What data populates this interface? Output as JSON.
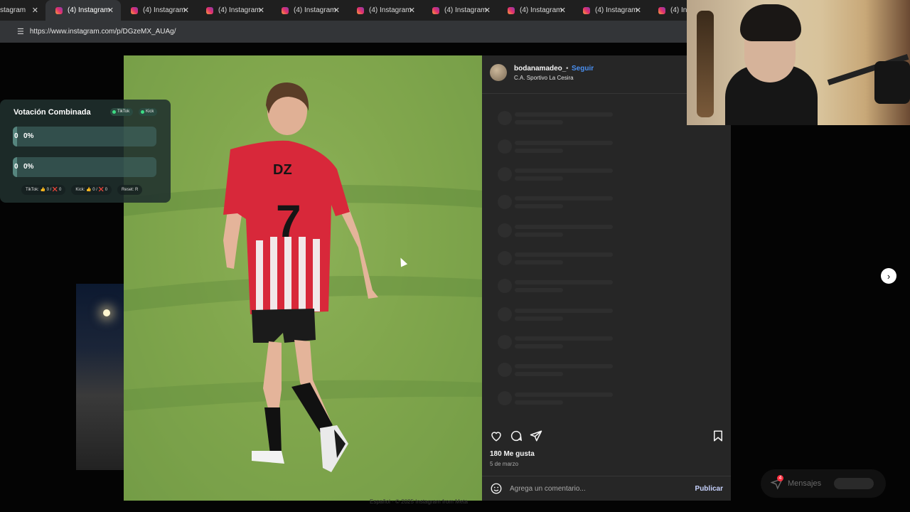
{
  "browser": {
    "first_tab_label": "stagram",
    "tabs": [
      {
        "label": "(4) Instagram",
        "active": true
      },
      {
        "label": "(4) Instagram",
        "active": false
      },
      {
        "label": "(4) Instagram",
        "active": false
      },
      {
        "label": "(4) Instagram",
        "active": false
      },
      {
        "label": "(4) Instagram",
        "active": false
      },
      {
        "label": "(4) Instagram",
        "active": false
      },
      {
        "label": "(4) Instagram",
        "active": false
      },
      {
        "label": "(4) Instagram",
        "active": false
      },
      {
        "label": "(4) Insta",
        "active": false
      }
    ],
    "url": "https://www.instagram.com/p/DGzeMX_AUAg/"
  },
  "post": {
    "username": "bodanamadeo_",
    "separator": "•",
    "follow_label": "Seguir",
    "location": "C.A. Sportivo La Cesira",
    "likes": "180 Me gusta",
    "date": "5 de marzo",
    "comment_placeholder": "Agrega un comentario...",
    "publish_label": "Publicar",
    "jersey_number": "7",
    "jersey_brand": "DZ"
  },
  "footer": {
    "text": "Español   ·   © 2025 Instagram from Meta"
  },
  "messages": {
    "label": "Mensajes",
    "badge": "4"
  },
  "vote_widget": {
    "title": "Votación Combinada",
    "sources": [
      "TikTok",
      "Kick"
    ],
    "options": [
      {
        "value": "0",
        "percent": "0%"
      },
      {
        "value": "0",
        "percent": "0%"
      }
    ],
    "stats": [
      "TikTok: 👍 0 / ❌ 0",
      "Kick: 👍 0 / ❌ 0",
      "Reset: R"
    ]
  },
  "colors": {
    "accent_blue": "#4a8ff0",
    "jersey_red": "#d8283a",
    "panel_bg": "#262626"
  },
  "icons": {
    "heart": "heart-icon",
    "comment": "comment-icon",
    "share": "share-icon",
    "bookmark": "bookmark-icon",
    "next": "chevron-right-icon"
  }
}
